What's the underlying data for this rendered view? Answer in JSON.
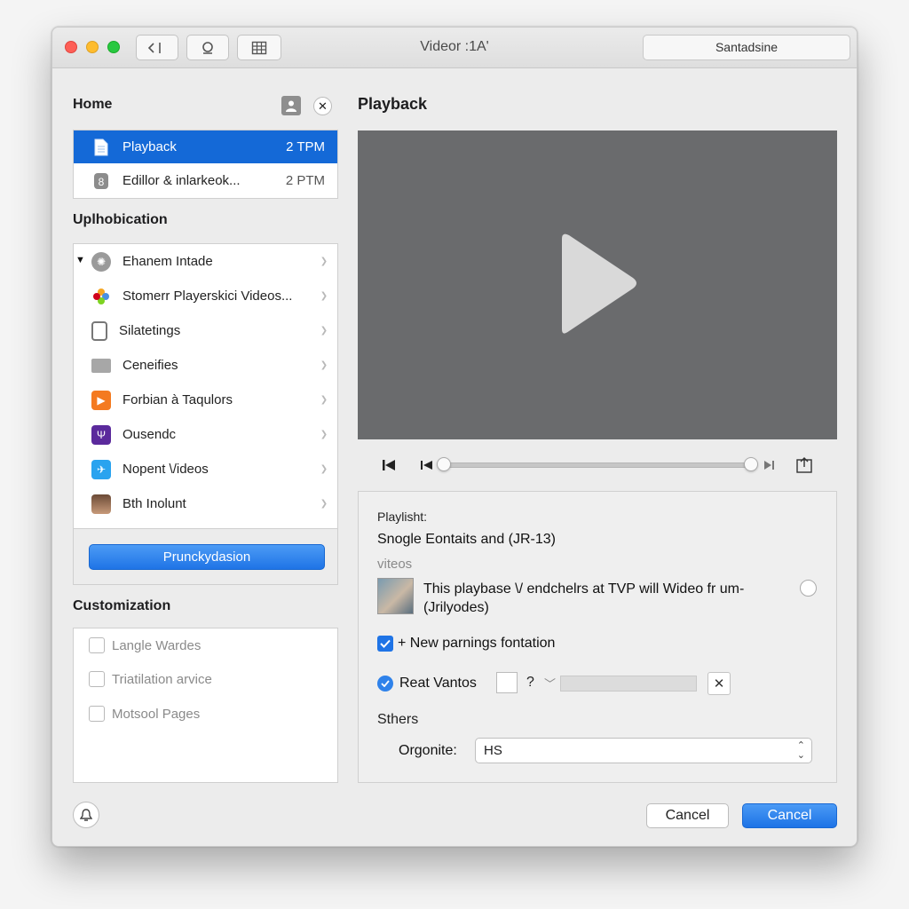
{
  "window": {
    "title": "Videor :1A'"
  },
  "toolbar": {
    "search_text": "Santadsine"
  },
  "sidebar": {
    "home_heading": "Home",
    "home_items": [
      {
        "label": "Playback",
        "time": "2 TPM",
        "selected": true
      },
      {
        "label": "Edillor & inlarkeok...",
        "time": "2 PTM",
        "selected": false
      }
    ],
    "apps_heading": "Uplhobication",
    "apps": [
      {
        "label": "Ehanem Intade",
        "icon": "gear-icon"
      },
      {
        "label": "Stomerr Playerskici Videos...",
        "icon": "photos-icon"
      },
      {
        "label": "Silatetings",
        "icon": "phone-icon"
      },
      {
        "label": "Ceneifies",
        "icon": "folder-icon"
      },
      {
        "label": "Forbian à Taqulors",
        "icon": "play-icon"
      },
      {
        "label": "Ousendc",
        "icon": "app-icon"
      },
      {
        "label": "Nopent \\/ideos",
        "icon": "bird-icon"
      },
      {
        "label": "Bth Inolunt",
        "icon": "avatar-icon"
      }
    ],
    "apps_button": "Prunckydasion",
    "custom_heading": "Customization",
    "custom_items": [
      {
        "label": "Langle Wardes"
      },
      {
        "label": "Triatilation arvice"
      },
      {
        "label": "Motsool Pages"
      }
    ]
  },
  "main": {
    "title": "Playback",
    "playlist_label": "Playlisht:",
    "playlist_title": "Snogle Eontaits and (JR-13)",
    "playlist_sub": "viteos",
    "description": "This playbase \\/ endchelrs at TVP will Wideo fr um- (Jrilyodes)",
    "new_parnings_label": "+ New parnings fontation",
    "reat_vantos_label": "Reat Vantos",
    "question_mark": "?",
    "sthers_label": "Sthers",
    "organite_label": "Orgonite:",
    "organite_value": "HS"
  },
  "footer": {
    "cancel_label": "Cancel",
    "confirm_label": "Cancel"
  },
  "colors": {
    "accent": "#1469d7",
    "video_bg": "#6a6b6d"
  }
}
